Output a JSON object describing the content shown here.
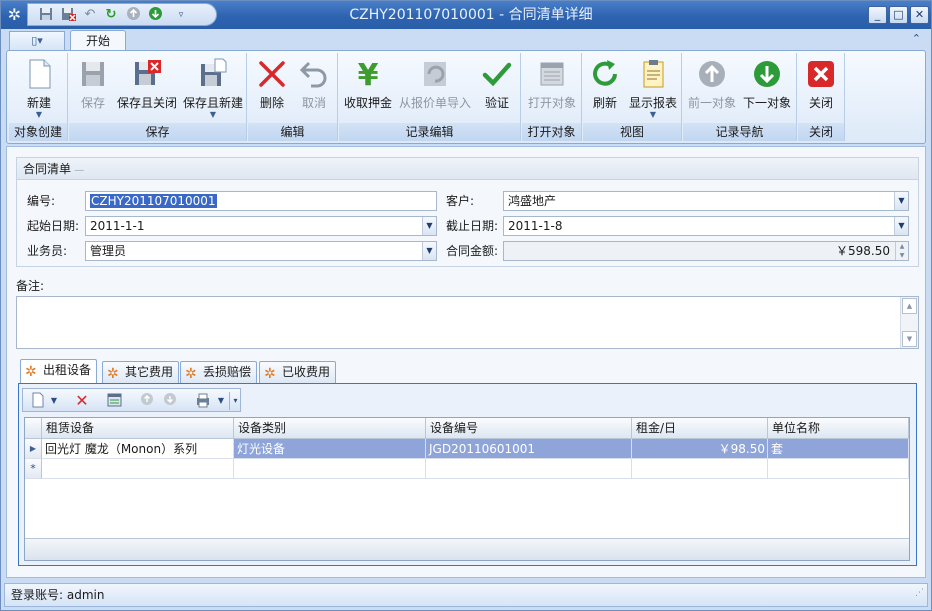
{
  "window": {
    "title": "CZHY201107010001 - 合同清单详细",
    "min_label": "_",
    "max_label": "□",
    "close_label": "✕"
  },
  "qat": {
    "icons": [
      "save-icon",
      "save-close-icon",
      "undo-icon",
      "refresh-icon",
      "prev-icon",
      "next-icon",
      "customize-icon"
    ]
  },
  "ribbon": {
    "menu_tab_label": "▯▾",
    "active_tab": "开始",
    "collapse_label": "⌃",
    "groups": [
      {
        "label": "对象创建",
        "buttons": [
          {
            "label": "新建"
          }
        ]
      },
      {
        "label": "保存",
        "buttons": [
          {
            "label": "保存"
          },
          {
            "label": "保存且关闭"
          },
          {
            "label": "保存且新建"
          }
        ]
      },
      {
        "label": "编辑",
        "buttons": [
          {
            "label": "删除"
          },
          {
            "label": "取消"
          }
        ]
      },
      {
        "label": "记录编辑",
        "buttons": [
          {
            "label": "收取押金"
          },
          {
            "label": "从报价单导入"
          },
          {
            "label": "验证"
          }
        ]
      },
      {
        "label": "打开对象",
        "buttons": [
          {
            "label": "打开对象"
          }
        ]
      },
      {
        "label": "视图",
        "buttons": [
          {
            "label": "刷新"
          },
          {
            "label": "显示报表"
          }
        ]
      },
      {
        "label": "记录导航",
        "buttons": [
          {
            "label": "前一对象"
          },
          {
            "label": "下一对象"
          }
        ]
      },
      {
        "label": "关闭",
        "buttons": [
          {
            "label": "关闭"
          }
        ]
      }
    ]
  },
  "form": {
    "section_title": "合同清单",
    "fields": {
      "code": {
        "label": "编号:",
        "value": "CZHY201107010001"
      },
      "customer": {
        "label": "客户:",
        "value": "鸿盛地产"
      },
      "start_date": {
        "label": "起始日期:",
        "value": "2011-1-1"
      },
      "end_date": {
        "label": "截止日期:",
        "value": "2011-1-8"
      },
      "salesman": {
        "label": "业务员:",
        "value": "管理员"
      },
      "amount": {
        "label": "合同金额:",
        "value": "￥598.50"
      }
    },
    "remark_label": "备注:",
    "remark_value": ""
  },
  "detail_tabs": [
    {
      "label": "出租设备"
    },
    {
      "label": "其它费用"
    },
    {
      "label": "丢损赔偿"
    },
    {
      "label": "已收费用"
    }
  ],
  "grid": {
    "columns": [
      "租赁设备",
      "设备类别",
      "设备编号",
      "租金/日",
      "单位名称"
    ],
    "rows": [
      {
        "device": "回光灯  魔龙（Monon）系列",
        "category": "灯光设备",
        "code": "JGD20110601001",
        "rent": "￥98.50",
        "unit": "套"
      }
    ],
    "new_row_marker": "*"
  },
  "status": {
    "login_label": "登录账号: admin"
  },
  "colors": {
    "title_bar": "#2d63b0",
    "ribbon_bg": "#dde9f8",
    "selection": "#8fa5d9",
    "accent": "#3a76c8"
  }
}
